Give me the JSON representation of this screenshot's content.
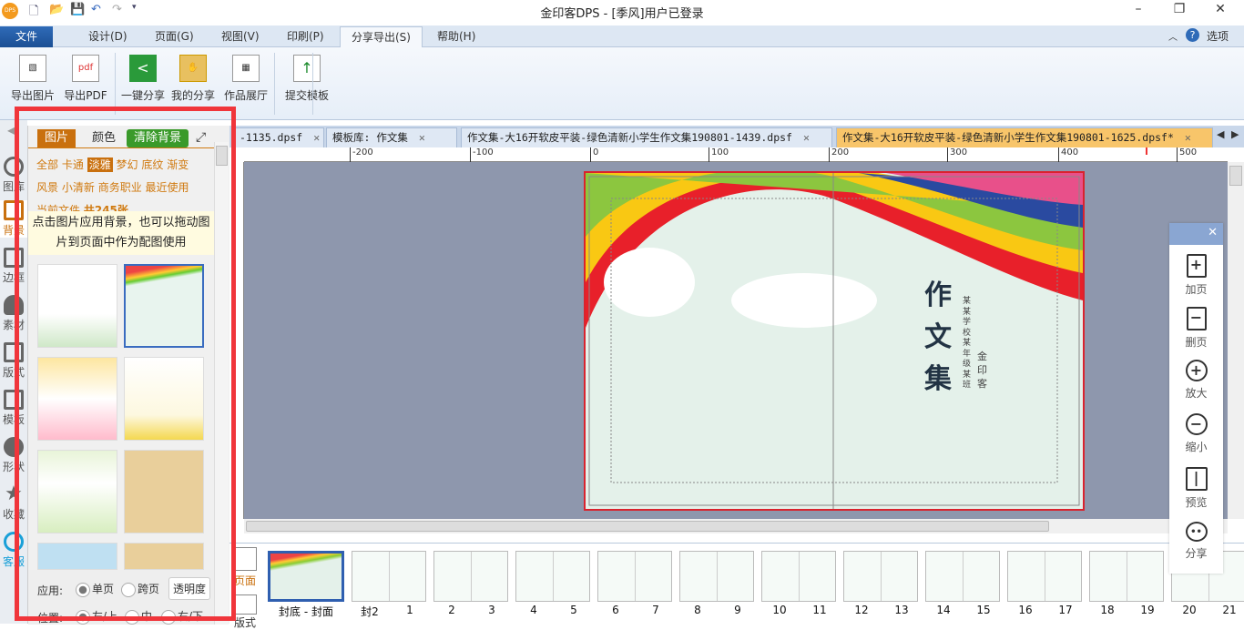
{
  "window": {
    "title": "金印客DPS - [季风]用户已登录",
    "logo": "DPS"
  },
  "menu": {
    "tabs": [
      "文件(F)",
      "设计(D)",
      "页面(G)",
      "视图(V)",
      "印刷(P)",
      "分享导出(S)",
      "帮助(H)"
    ],
    "options": "选项"
  },
  "ribbon": {
    "buttons": [
      "导出图片",
      "导出PDF",
      "一键分享",
      "我的分享",
      "作品展厅",
      "提交模板"
    ]
  },
  "leftstrip": {
    "items": [
      "图库",
      "背景",
      "边框",
      "素材",
      "版式",
      "模板",
      "形状",
      "收藏",
      "客服"
    ]
  },
  "panel": {
    "tabs": [
      "图片",
      "颜色"
    ],
    "clear": "清除背景",
    "categories": [
      "全部",
      "卡通",
      "淡雅",
      "梦幻",
      "底纹",
      "渐变",
      "风景",
      "小清新",
      "商务职业",
      "最近使用"
    ],
    "count_label": "当前文件",
    "count": "共245张",
    "hint": "点击图片应用背景，也可以拖动图片到页面中作为配图使用",
    "apply_label": "应用:",
    "apply_options": [
      "单页",
      "跨页"
    ],
    "opacity": "透明度",
    "pos_label": "位置:",
    "pos_options": [
      "左/上",
      "中",
      "右/下"
    ]
  },
  "doctabs": [
    "-1135.dpsf",
    "模板库: 作文集",
    "作文集-大16开软皮平装-绿色清新小学生作文集190801-1439.dpsf",
    "作文集-大16开软皮平装-绿色清新小学生作文集190801-1625.dpsf*"
  ],
  "ruler": [
    "-200",
    "-100",
    "0",
    "100",
    "200",
    "300",
    "400",
    "500"
  ],
  "cover": {
    "title": [
      "作",
      "文",
      "集"
    ],
    "school": "某某学校某年级某班",
    "brand": "金印客"
  },
  "float": {
    "items": [
      "加页",
      "删页",
      "放大",
      "缩小",
      "预览",
      "分享"
    ]
  },
  "strip": {
    "side": [
      "页面",
      "版式"
    ],
    "labels": [
      "封底 - 封面",
      "封2",
      "1",
      "2",
      "3",
      "4",
      "5",
      "6",
      "7",
      "8",
      "9",
      "10",
      "11",
      "12",
      "13",
      "14",
      "15",
      "16",
      "17",
      "18",
      "19",
      "20",
      "21"
    ]
  }
}
